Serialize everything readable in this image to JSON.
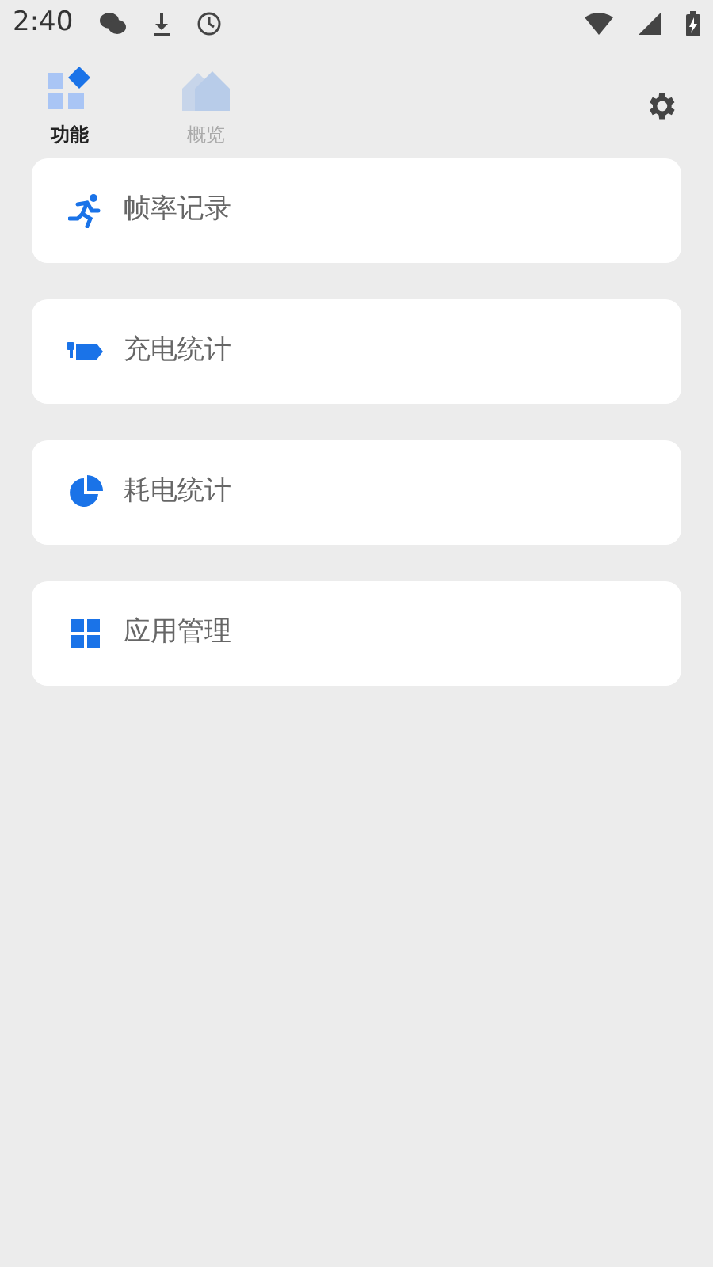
{
  "status_bar": {
    "time": "2:40"
  },
  "tabs": [
    {
      "label": "功能",
      "selected": true
    },
    {
      "label": "概览",
      "selected": false
    }
  ],
  "menu": [
    {
      "kind": "run",
      "label": "帧率记录"
    },
    {
      "kind": "charge",
      "label": "充电统计"
    },
    {
      "kind": "pie",
      "label": "耗电统计"
    },
    {
      "kind": "grid",
      "label": "应用管理"
    }
  ]
}
